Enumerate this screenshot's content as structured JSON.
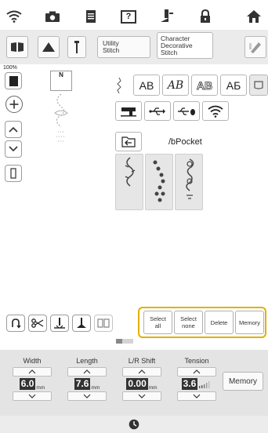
{
  "top_bar": {
    "icons": [
      "wifi-icon",
      "camera-icon",
      "document-icon",
      "help-icon",
      "presser-foot-icon",
      "lock-icon",
      "home-icon"
    ],
    "help_label": "?"
  },
  "mode_bar": {
    "utility_label_1": "Utility",
    "utility_label_2": "Stitch",
    "character_label_1": "Character",
    "character_label_2": "Decorative",
    "character_label_3": "Stitch"
  },
  "left_panel": {
    "zoom": "100%",
    "foot_label": "N"
  },
  "font_tabs": [
    "AB",
    "AB",
    "AB",
    "АБ"
  ],
  "source": {
    "path": "/bPocket"
  },
  "actions": {
    "select_all_1": "Select",
    "select_all_2": "all",
    "select_none_1": "Select",
    "select_none_2": "none",
    "delete": "Delete",
    "memory": "Memory"
  },
  "controls": {
    "width": {
      "label": "Width",
      "value": "6.0",
      "unit": "mm"
    },
    "length": {
      "label": "Length",
      "value": "7.6",
      "unit": "mm"
    },
    "lr_shift": {
      "label": "L/R Shift",
      "value": "0.00",
      "unit": "mm"
    },
    "tension": {
      "label": "Tension",
      "value": "3.6"
    },
    "memory_label": "Memory"
  },
  "colors": {
    "highlight_border": "#e2b000",
    "panel_bg": "#e4e4e4",
    "value_bg": "#333333"
  }
}
